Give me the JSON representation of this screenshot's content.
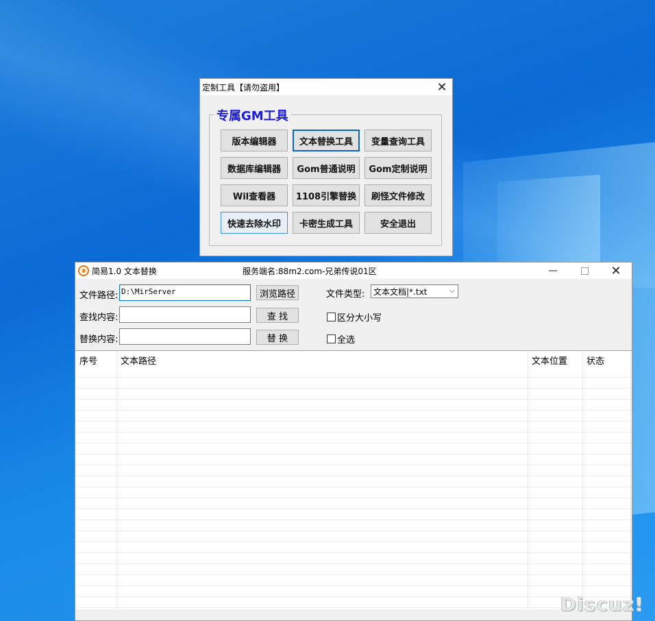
{
  "gm_window": {
    "title": "定制工具【请勿盗用】",
    "close": "✕",
    "group_title": "专属GM工具",
    "buttons": [
      "版本编辑器",
      "文本替换工具",
      "变量查询工具",
      "数据库编辑器",
      "Gom普通说明",
      "Gom定制说明",
      "Wil查看器",
      "1108引擎替换",
      "刷怪文件修改",
      "快速去除水印",
      "卡密生成工具",
      "安全退出"
    ]
  },
  "replace_window": {
    "title": "简易1.0 文本替换",
    "server": "服务端名:88m2.com-兄弟传说01区",
    "minimize": "—",
    "close": "✕",
    "path_label": "文件路径:",
    "path_value": "D:\\MirServer",
    "browse_button": "浏览路径",
    "find_label": "查找内容:",
    "find_value": "",
    "find_button": "查 找",
    "replace_label": "替换内容:",
    "replace_value": "",
    "replace_button": "替 换",
    "filetype_label": "文件类型:",
    "filetype_value": "文本文档|*.txt",
    "case_label": "区分大小写",
    "select_all_label": "全选",
    "columns": [
      "序号",
      "文本路径",
      "文本位置",
      "状态"
    ]
  },
  "watermark": "Discuz!"
}
